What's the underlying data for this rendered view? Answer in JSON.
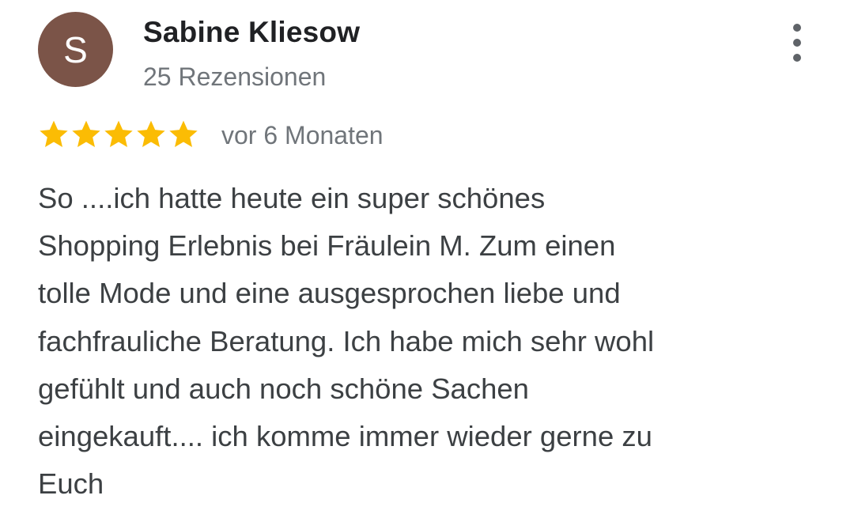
{
  "review": {
    "author": {
      "initial": "S",
      "name": "Sabine Kliesow",
      "review_count": "25 Rezensionen",
      "avatar_color": "#7b5448"
    },
    "rating": 5,
    "rating_max": 5,
    "star_color": "#fbbc04",
    "timestamp": "vor 6 Monaten",
    "text": "So ....ich hatte heute ein super schönes\nShopping Erlebnis bei Fräulein M. Zum einen\ntolle Mode und eine ausgesprochen liebe und\nfachfrauliche Beratung. Ich habe mich sehr wohl\ngefühlt und auch noch schöne Sachen\neingekauft.... ich komme immer wieder gerne zu\nEuch",
    "menu_icon": "more-vert-icon"
  }
}
